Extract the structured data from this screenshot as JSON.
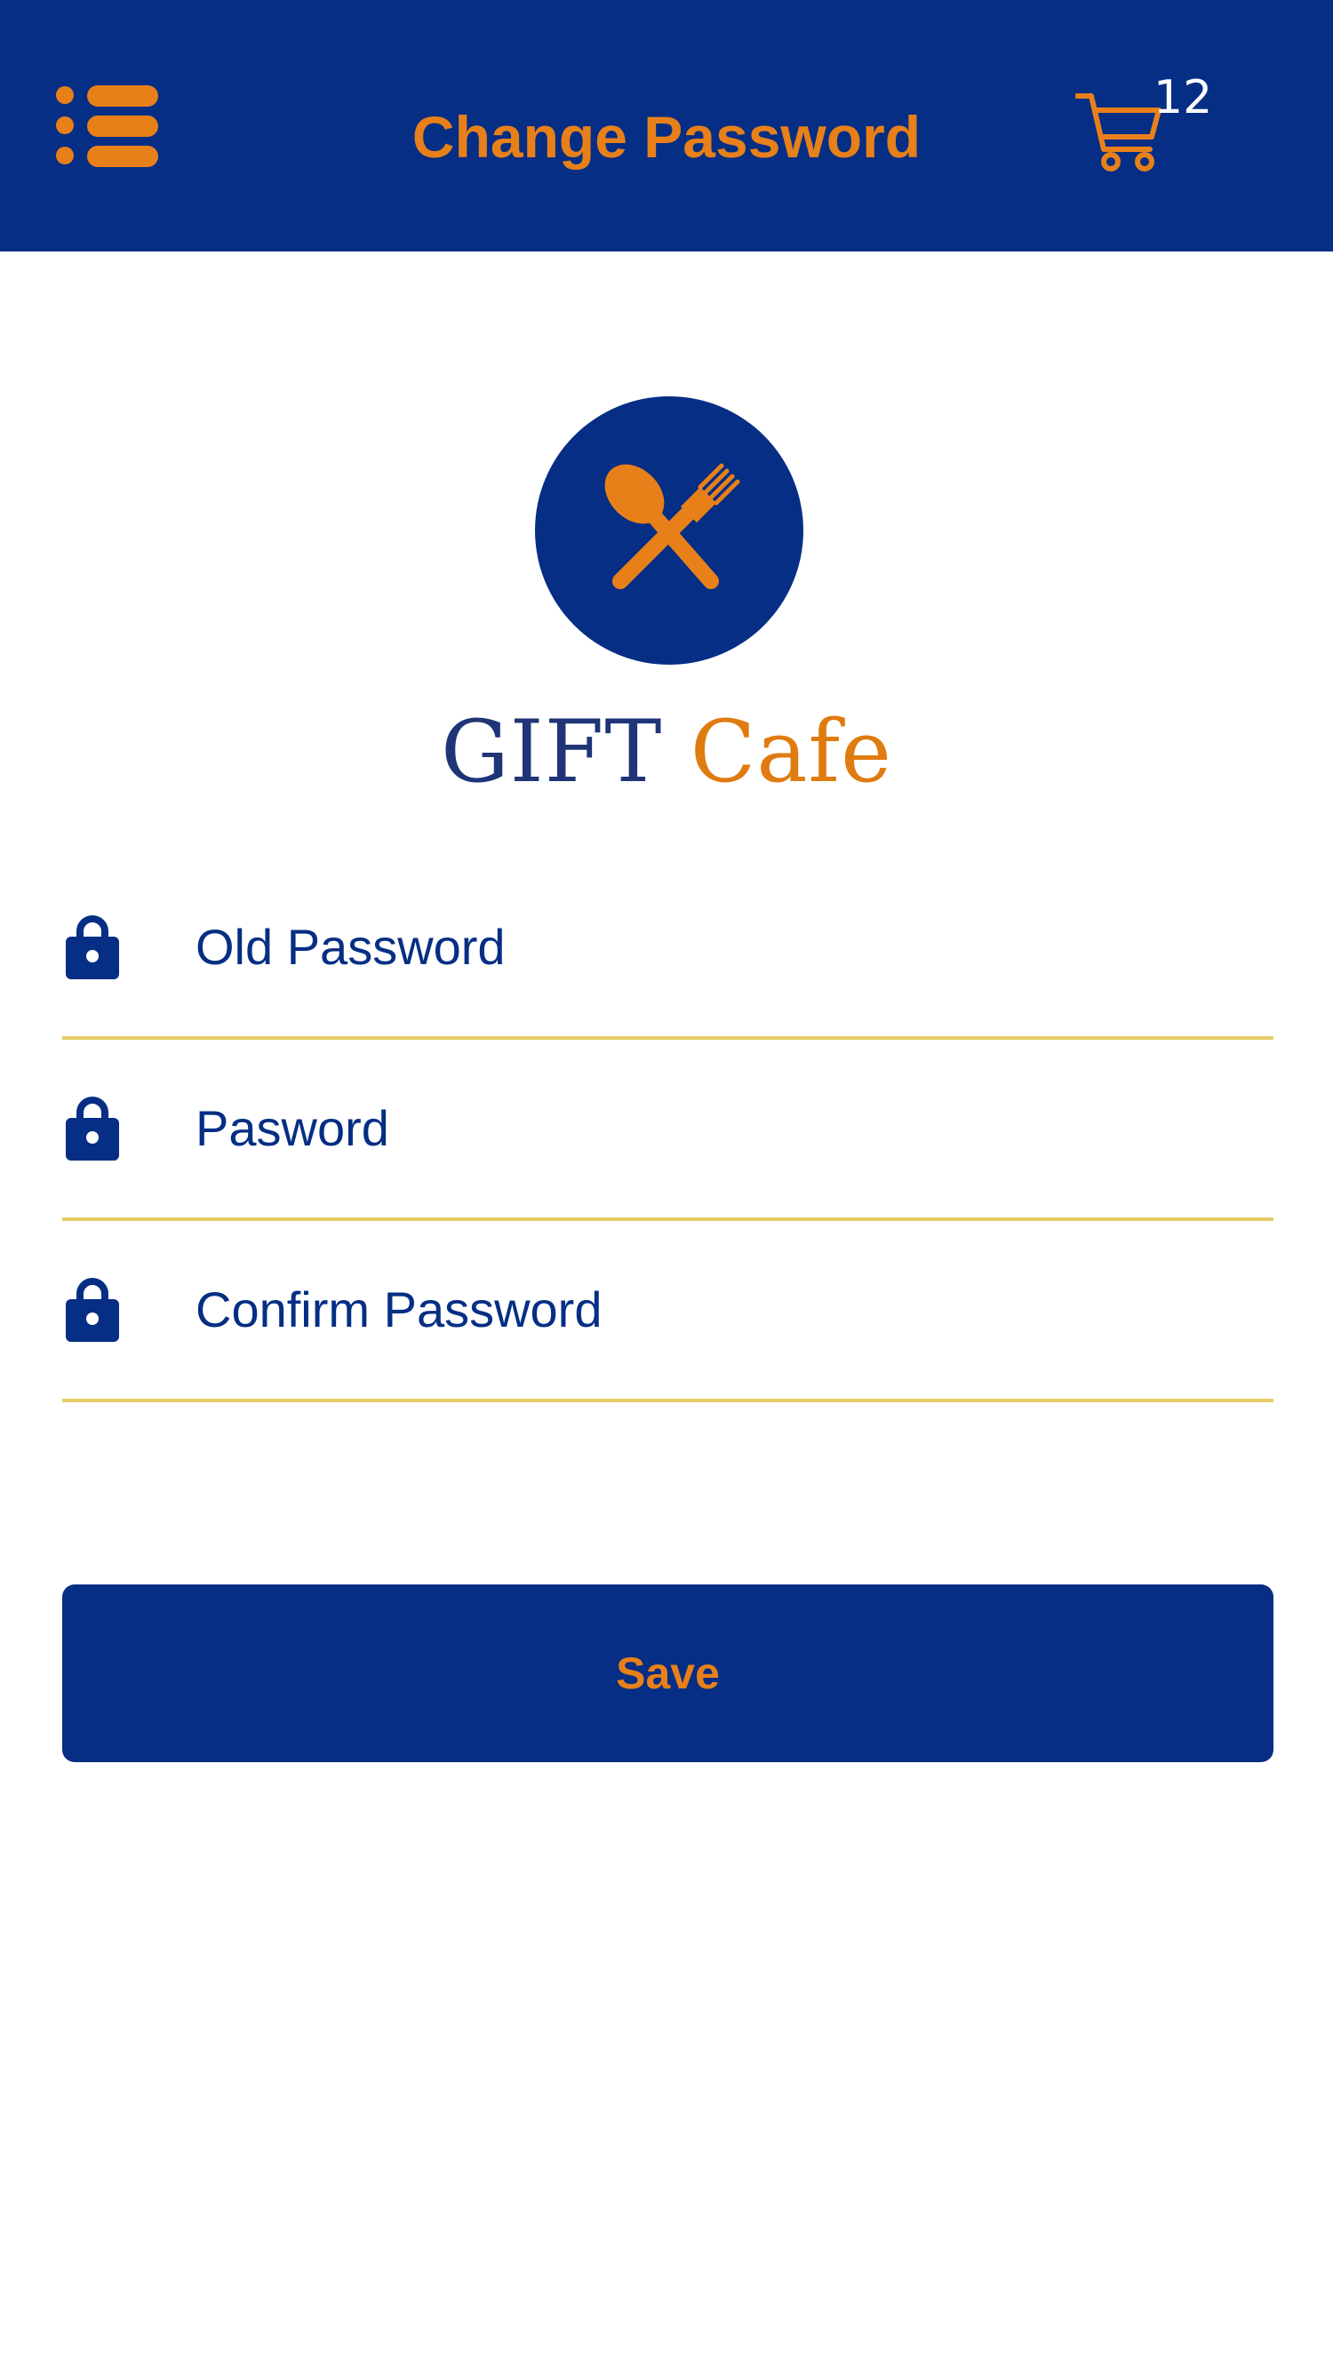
{
  "header": {
    "title": "Change Password",
    "menu_icon": "list-menu-icon",
    "cart_icon": "shopping-cart-icon",
    "cart_count": "12"
  },
  "logo": {
    "icon": "spoon-fork-icon",
    "brand_part1": "GIFT",
    "brand_part2": "Cafe"
  },
  "form": {
    "old_password_placeholder": "Old Password",
    "password_placeholder": "Pasword",
    "confirm_password_placeholder": "Confirm Password",
    "lock_icon": "lock-icon"
  },
  "actions": {
    "save_label": "Save"
  },
  "colors": {
    "primary": "#052e84",
    "accent": "#e8801a",
    "underline": "#e7cc66",
    "background": "#ffffff"
  }
}
